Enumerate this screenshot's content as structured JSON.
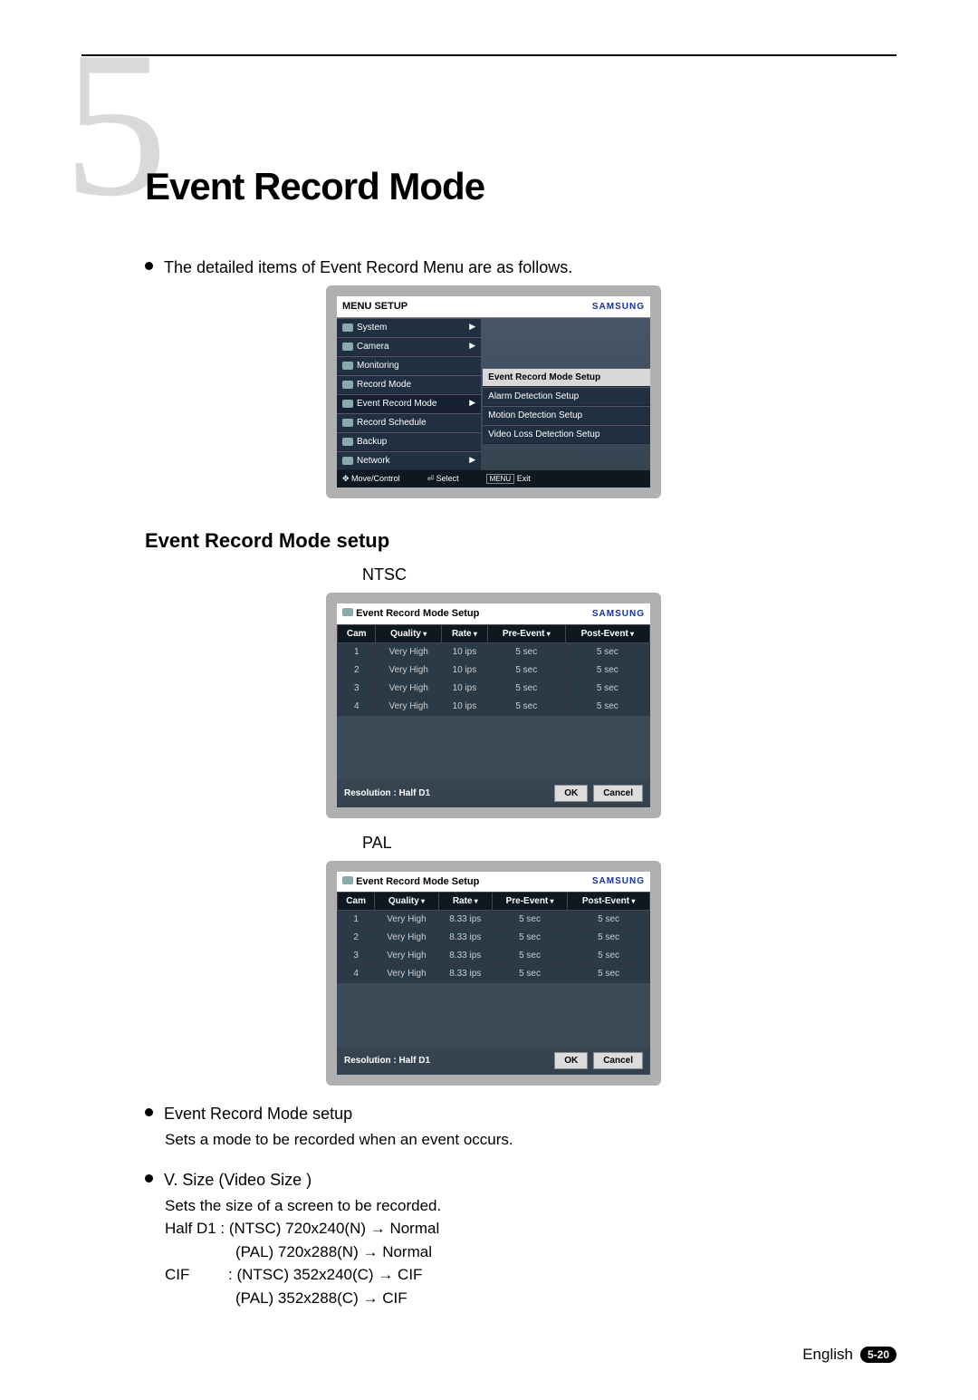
{
  "chapter": {
    "number": "5",
    "title": "Event Record Mode"
  },
  "intro_bullet": "The detailed items of Event Record Menu are as follows.",
  "menu_screen": {
    "title": "MENU SETUP",
    "brand": "SAMSUNG",
    "left_items": [
      "System",
      "Camera",
      "Monitoring",
      "Record Mode",
      "Event Record Mode",
      "Record Schedule",
      "Backup",
      "Network"
    ],
    "right_items": [
      "Event Record Mode Setup",
      "Alarm Detection Setup",
      "Motion Detection Setup",
      "Video Loss Detection Setup"
    ],
    "footer": {
      "move": "Move/Control",
      "select": "Select",
      "exit": "Exit"
    }
  },
  "section_title": "Event Record Mode setup",
  "ntsc_label": "NTSC",
  "pal_label": "PAL",
  "table_common": {
    "title": "Event Record Mode Setup",
    "brand": "SAMSUNG",
    "headers": [
      "Cam",
      "Quality",
      "Rate",
      "Pre-Event",
      "Post-Event"
    ],
    "resolution": "Resolution : Half D1",
    "ok": "OK",
    "cancel": "Cancel"
  },
  "ntsc_rows": [
    {
      "cam": "1",
      "q": "Very High",
      "rate": "10 ips",
      "pre": "5 sec",
      "post": "5 sec"
    },
    {
      "cam": "2",
      "q": "Very High",
      "rate": "10 ips",
      "pre": "5 sec",
      "post": "5 sec"
    },
    {
      "cam": "3",
      "q": "Very High",
      "rate": "10 ips",
      "pre": "5 sec",
      "post": "5 sec"
    },
    {
      "cam": "4",
      "q": "Very High",
      "rate": "10 ips",
      "pre": "5 sec",
      "post": "5 sec"
    }
  ],
  "pal_rows": [
    {
      "cam": "1",
      "q": "Very High",
      "rate": "8.33 ips",
      "pre": "5 sec",
      "post": "5 sec"
    },
    {
      "cam": "2",
      "q": "Very High",
      "rate": "8.33 ips",
      "pre": "5 sec",
      "post": "5 sec"
    },
    {
      "cam": "3",
      "q": "Very High",
      "rate": "8.33 ips",
      "pre": "5 sec",
      "post": "5 sec"
    },
    {
      "cam": "4",
      "q": "Very High",
      "rate": "8.33 ips",
      "pre": "5 sec",
      "post": "5 sec"
    }
  ],
  "desc1": {
    "head": "Event Record Mode setup",
    "body": "Sets a mode to be recorded when an event occurs."
  },
  "desc2": {
    "head": "V. Size (Video Size )",
    "body": "Sets the size of a screen to be recorded.",
    "l1a": "Half D1 : (NTSC) 720x240(N)  →  Normal",
    "l1b": "(PAL) 720x288(N)  →  Normal",
    "l2a_label": "CIF",
    "l2a_rest": ": (NTSC) 352x240(C)  →  CIF",
    "l2b": "(PAL) 352x288(C)  →  CIF"
  },
  "footer": {
    "lang": "English",
    "page": "5-20"
  }
}
